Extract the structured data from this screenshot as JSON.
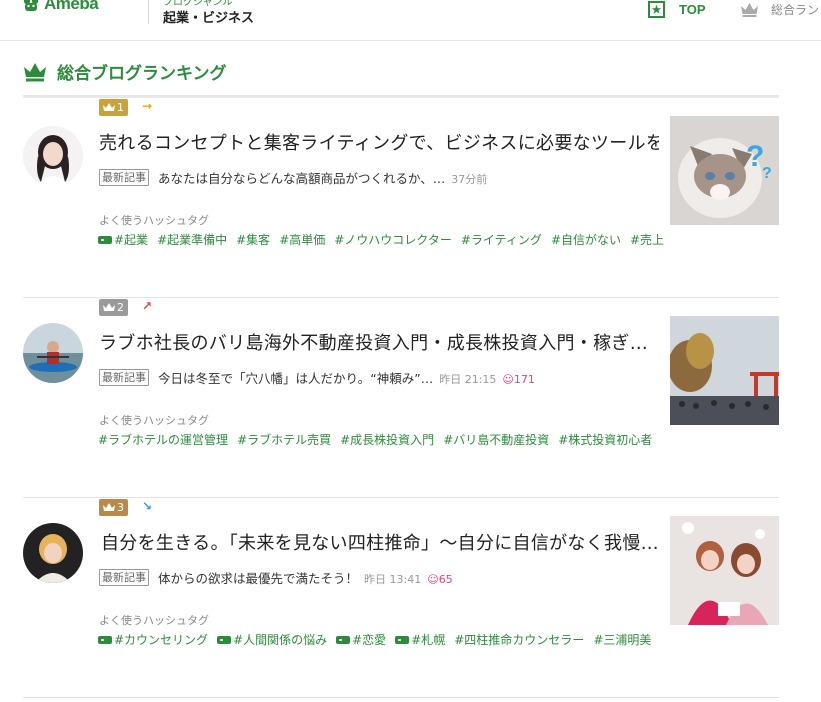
{
  "header": {
    "logo_text": "Ameba",
    "category_sublabel": "ブログジャンル",
    "category_label": "起業・ビジネス",
    "nav_top_label": "TOP",
    "nav_ranking_label": "総合ラン"
  },
  "section": {
    "title": "総合ブログランキング"
  },
  "colors": {
    "brand_green": "#2d8c3c",
    "gold": "#c9a23a",
    "silver": "#9a9a9a",
    "bronze": "#b98a4a",
    "likes": "#e0457b"
  },
  "entries": [
    {
      "rank": "1",
      "trend": "→",
      "trend_icon": "arrow-flat-icon",
      "title": "売れるコンセプトと集客ライティングで、ビジネスに必要なツールを…",
      "latest_label": "最新記事",
      "snippet": "あなたは自分ならどんな高額商品がつくれるか、…",
      "time": "37分前",
      "likes": "",
      "hashtag_label": "よく使うハッシュタグ",
      "tags": [
        {
          "text": "#起業",
          "pill": true
        },
        {
          "text": "#起業準備中",
          "pill": false
        },
        {
          "text": "#集客",
          "pill": false
        },
        {
          "text": "#高単価",
          "pill": false
        },
        {
          "text": "#ノウハウコレクター",
          "pill": false
        },
        {
          "text": "#ライティング",
          "pill": false
        },
        {
          "text": "#自信がない",
          "pill": false
        },
        {
          "text": "#売上",
          "pill": false
        }
      ]
    },
    {
      "rank": "2",
      "trend": "↗",
      "trend_icon": "arrow-up-icon",
      "title": "ラブホ社長のバリ島海外不動産投資入門・成長株投資入門・稼ぎ…",
      "latest_label": "最新記事",
      "snippet": "今日は冬至で「穴八幡」は人だかり。“神頼み”…",
      "time": "昨日 21:15",
      "likes": "171",
      "hashtag_label": "よく使うハッシュタグ",
      "tags": [
        {
          "text": "#ラブホテルの運営管理",
          "pill": false
        },
        {
          "text": "#ラブホテル売買",
          "pill": false
        },
        {
          "text": "#成長株投資入門",
          "pill": false
        },
        {
          "text": "#バリ島不動産投資",
          "pill": false
        },
        {
          "text": "#株式投資初心者",
          "pill": false
        }
      ]
    },
    {
      "rank": "3",
      "trend": "↘",
      "trend_icon": "arrow-down-icon",
      "title": "自分を生きる。「未来を見ない四柱推命」〜自分に自信がなく我慢…",
      "latest_label": "最新記事",
      "snippet": "体からの欲求は最優先で満たそう！",
      "time": "昨日 13:41",
      "likes": "65",
      "hashtag_label": "よく使うハッシュタグ",
      "tags": [
        {
          "text": "#カウンセリング",
          "pill": true
        },
        {
          "text": "#人間関係の悩み",
          "pill": true
        },
        {
          "text": "#恋愛",
          "pill": true
        },
        {
          "text": "#札幌",
          "pill": true
        },
        {
          "text": "#四柱推命カウンセラー",
          "pill": false
        },
        {
          "text": "#三浦明美",
          "pill": false
        }
      ]
    }
  ]
}
